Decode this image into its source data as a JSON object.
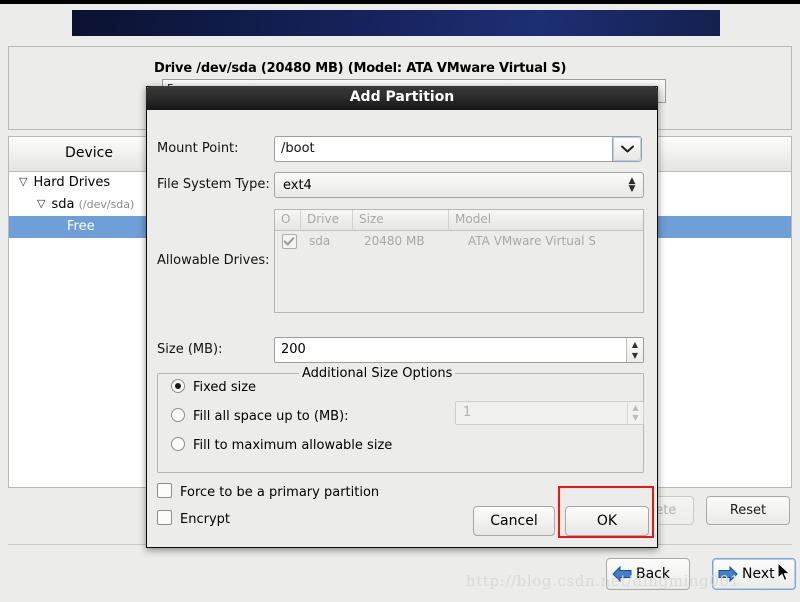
{
  "installer": {
    "drive_panel": {
      "title": "Drive /dev/sda (20480 MB) (Model: ATA VMware Virtual S)",
      "bar_label": "Free"
    },
    "device_table": {
      "header": "Device",
      "rows": [
        {
          "label": "Hard Drives",
          "detail": "",
          "selected": false
        },
        {
          "label": "sda",
          "detail": "(/dev/sda)",
          "selected": false
        },
        {
          "label": "Free",
          "detail": "",
          "selected": true
        }
      ]
    },
    "buttons": {
      "delete": "Delete",
      "reset": "Reset",
      "back": "Back",
      "next": "Next"
    },
    "watermark": "http://blog.csdn.net/dingming001"
  },
  "dialog": {
    "title": "Add Partition",
    "labels": {
      "mount_point": "Mount Point:",
      "file_system_type": "File System Type:",
      "allowable_drives": "Allowable Drives:",
      "size_mb": "Size (MB):"
    },
    "mount_point": {
      "value": "/boot",
      "icon": "chevron-down-icon"
    },
    "file_system_type": {
      "value": "ext4",
      "icon": "chevron-updown-icon"
    },
    "allowable_drives": {
      "columns": [
        "O",
        "Drive",
        "Size",
        "Model"
      ],
      "rows": [
        {
          "checked": "✓",
          "drive": "sda",
          "size": "20480 MB",
          "model": "ATA VMware Virtual S"
        }
      ]
    },
    "size": {
      "value": "200"
    },
    "size_options": {
      "group_title": "Additional Size Options",
      "options": [
        {
          "label": "Fixed size",
          "selected": true
        },
        {
          "label": "Fill all space up to (MB):",
          "selected": false
        },
        {
          "label": "Fill to maximum allowable size",
          "selected": false
        }
      ],
      "fill_upto_value": "1"
    },
    "checkboxes": [
      {
        "label": "Force to be a primary partition",
        "checked": false
      },
      {
        "label": "Encrypt",
        "checked": false
      }
    ],
    "buttons": {
      "cancel": "Cancel",
      "ok": "OK"
    }
  },
  "colors": {
    "selection_blue": "#6f9fd8",
    "banner_blue": "#16225c",
    "highlight_red": "#f01414",
    "window_bg": "#ececeb"
  }
}
